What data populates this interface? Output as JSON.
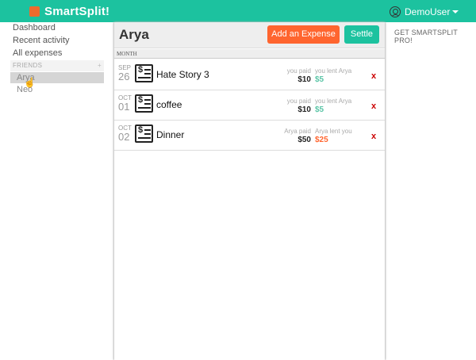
{
  "header": {
    "brand": "SmartSplit!",
    "user_name": "DemoUser",
    "colors": {
      "bar": "#1cc29f",
      "logo": "#ee6b2d"
    }
  },
  "sidebar": {
    "links": [
      {
        "label": "Dashboard"
      },
      {
        "label": "Recent activity"
      },
      {
        "label": "All expenses"
      }
    ],
    "friends_heading": "FRIENDS",
    "friends_add": "+",
    "friends": [
      {
        "name": "Arya",
        "active": true
      },
      {
        "name": "Neo",
        "active": false
      }
    ]
  },
  "main": {
    "title": "Arya",
    "add_expense_label": "Add an Expense",
    "settle_label": "Settle",
    "month_label": "MONTH",
    "expenses": [
      {
        "month": "SEP",
        "day": "26",
        "description": "Hate Story 3",
        "paid_label": "you paid",
        "paid_amount": "$10",
        "lent_label": "you lent Arya",
        "lent_amount": "$5",
        "lent_color": "#5bc5a7",
        "delete_label": "x"
      },
      {
        "month": "OCT",
        "day": "01",
        "description": "coffee",
        "paid_label": "you paid",
        "paid_amount": "$10",
        "lent_label": "you lent Arya",
        "lent_amount": "$5",
        "lent_color": "#5bc5a7",
        "delete_label": "x"
      },
      {
        "month": "OCT",
        "day": "02",
        "description": "Dinner",
        "paid_label": "Arya paid",
        "paid_amount": "$50",
        "lent_label": "Arya lent you",
        "lent_amount": "$25",
        "lent_color": "#ff652f",
        "delete_label": "x"
      }
    ]
  },
  "right": {
    "promo": "GET SMARTSPLIT PRO!"
  },
  "icons": {
    "cursor": "hand-pointer"
  }
}
